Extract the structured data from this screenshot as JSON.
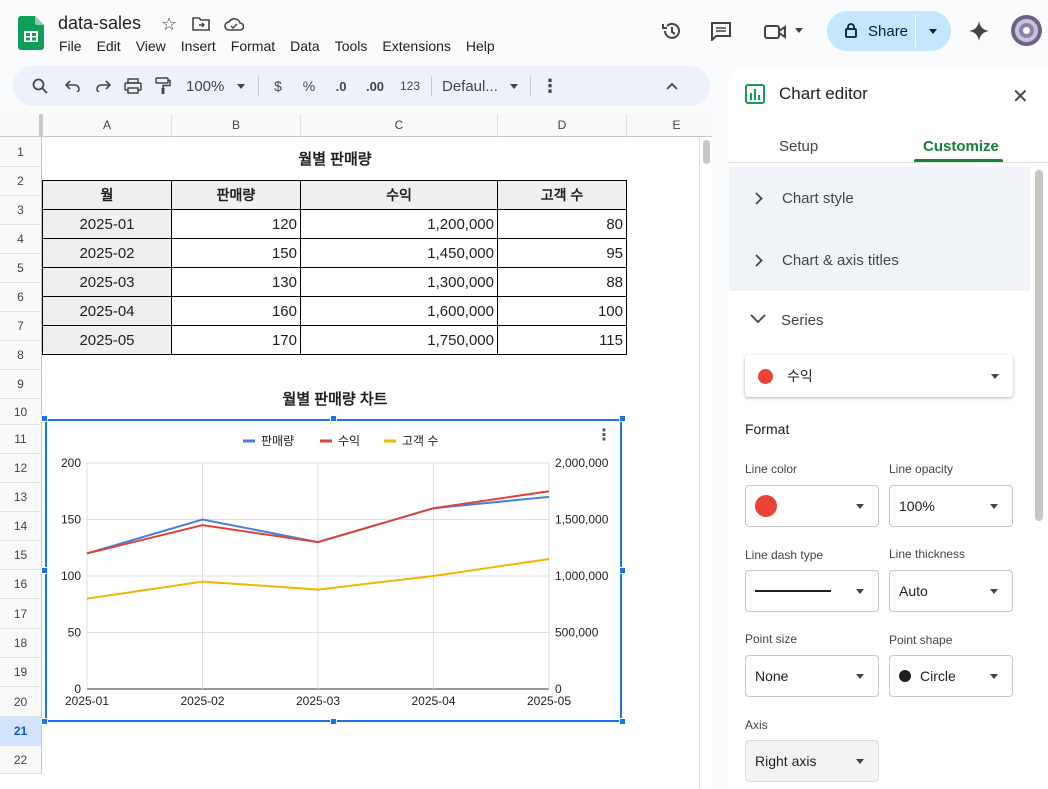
{
  "doc": {
    "title": "data-sales"
  },
  "menu": [
    "File",
    "Edit",
    "View",
    "Insert",
    "Format",
    "Data",
    "Tools",
    "Extensions",
    "Help"
  ],
  "share": {
    "label": "Share"
  },
  "toolbar": {
    "zoom": "100%",
    "currency": "$",
    "percent": "%",
    "dec_less": ".0",
    "dec_more": ".00",
    "number_format": "123",
    "font": "Defaul..."
  },
  "columns": [
    "A",
    "B",
    "C",
    "D",
    "E"
  ],
  "rows": [
    "1",
    "2",
    "3",
    "4",
    "5",
    "6",
    "7",
    "8",
    "9",
    "10",
    "11",
    "12",
    "13",
    "14",
    "15",
    "16",
    "17",
    "18",
    "19",
    "20",
    "21",
    "22"
  ],
  "sheet": {
    "title": "월별 판매량",
    "headers": [
      "월",
      "판매량",
      "수익",
      "고객 수"
    ],
    "data": [
      [
        "2025-01",
        "120",
        "1,200,000",
        "80"
      ],
      [
        "2025-02",
        "150",
        "1,450,000",
        "95"
      ],
      [
        "2025-03",
        "130",
        "1,300,000",
        "88"
      ],
      [
        "2025-04",
        "160",
        "1,600,000",
        "100"
      ],
      [
        "2025-05",
        "170",
        "1,750,000",
        "115"
      ]
    ],
    "chart_title": "월별 판매량 차트"
  },
  "chart_data": {
    "type": "line",
    "categories": [
      "2025-01",
      "2025-02",
      "2025-03",
      "2025-04",
      "2025-05"
    ],
    "series": [
      {
        "name": "판매량",
        "values": [
          120,
          150,
          130,
          160,
          170
        ],
        "axis": "left",
        "color": "#4a7fe0"
      },
      {
        "name": "수익",
        "values": [
          1200000,
          1450000,
          1300000,
          1600000,
          1750000
        ],
        "axis": "right",
        "color": "#db4437"
      },
      {
        "name": "고객 수",
        "values": [
          80,
          95,
          88,
          100,
          115
        ],
        "axis": "left",
        "color": "#f4b400"
      }
    ],
    "left_ticks": [
      "0",
      "50",
      "100",
      "150",
      "200"
    ],
    "right_ticks": [
      "0",
      "500,000",
      "1,000,000",
      "1,500,000",
      "2,000,000"
    ],
    "ylim_left": [
      0,
      200
    ],
    "ylim_right": [
      0,
      2000000
    ],
    "legend": "top",
    "grid": true
  },
  "editor": {
    "title": "Chart editor",
    "tabs": [
      "Setup",
      "Customize"
    ],
    "active_tab": "Customize",
    "sections": [
      "Chart style",
      "Chart & axis titles",
      "Series"
    ],
    "series_select": "수익",
    "format_label": "Format",
    "line_color_label": "Line color",
    "line_opacity_label": "Line opacity",
    "line_opacity": "100%",
    "line_dash_label": "Line dash type",
    "line_thickness_label": "Line thickness",
    "line_thickness": "Auto",
    "point_size_label": "Point size",
    "point_size": "None",
    "point_shape_label": "Point shape",
    "point_shape": "Circle",
    "axis_label": "Axis",
    "axis_value": "Right axis",
    "series_color": "#ea4335"
  }
}
